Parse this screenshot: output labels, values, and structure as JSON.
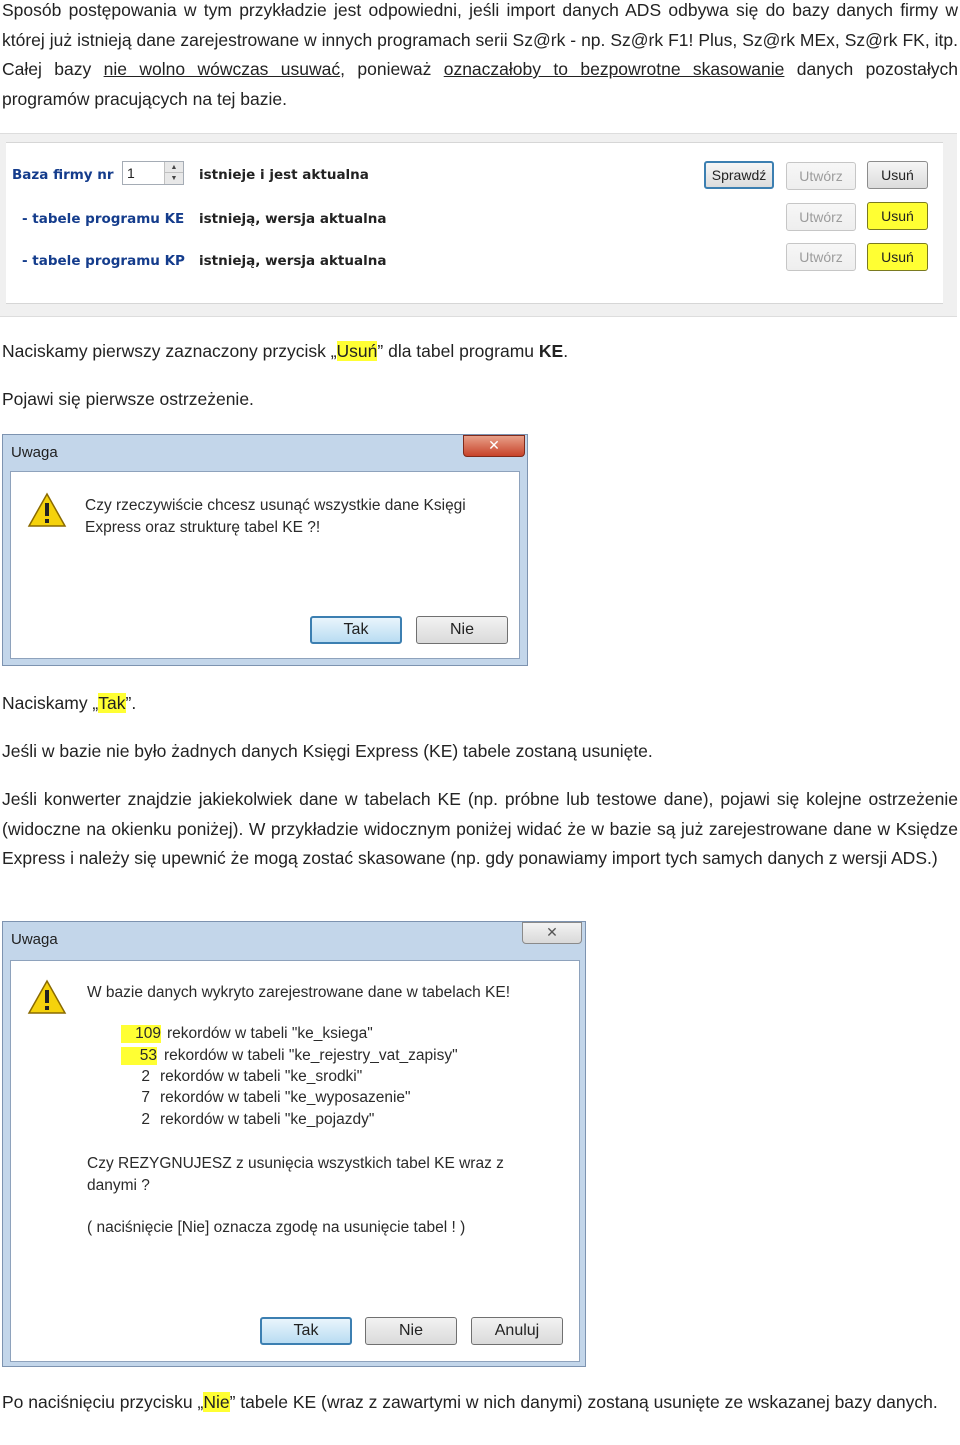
{
  "intro": {
    "line1": "Sposób postępowania w tym przykładzie jest odpowiedni, jeśli import danych ADS odbywa się do bazy danych firmy w której już istnieją dane zarejestrowane w innych programach serii Sz@rk - np. Sz@rk F1! Plus, Sz@rk MEx, Sz@rk FK, itp. Całej bazy ",
    "underline1": "nie wolno wówczas usuwać",
    "mid": ", ponieważ ",
    "underline2": "oznaczałoby to bezpowrotne skasowanie",
    "end": " danych pozostałych programów pracujących na tej bazie."
  },
  "panel": {
    "label_base": "Baza firmy nr",
    "spin_value": "1",
    "status_base": "istnieje i jest aktualna",
    "label_ke": "- tabele programu KE",
    "status_ke": "istnieją, wersja aktualna",
    "label_kp": "- tabele programu KP",
    "status_kp": "istnieją, wersja aktualna",
    "btn_check": "Sprawdź",
    "btn_create": "Utwórz",
    "btn_delete": "Usuń"
  },
  "step1": {
    "pre": "Naciskamy pierwszy zaznaczony przycisk „",
    "hl": "Usuń",
    "post": "” dla tabel programu ",
    "bold": "KE",
    "dot": "."
  },
  "step2": "Pojawi się pierwsze ostrzeżenie.",
  "dialog1": {
    "title": "Uwaga",
    "close": "✕",
    "msg1": "Czy rzeczywiście chcesz usunąć wszystkie dane Księgi",
    "msg2": "Express oraz strukturę tabel KE ?!",
    "yes": "Tak",
    "no": "Nie"
  },
  "step3": {
    "pre": "Naciskamy „",
    "hl": "Tak",
    "post": "”."
  },
  "para4": "Jeśli w bazie nie było żadnych danych Księgi Express (KE) tabele zostaną usunięte.",
  "para5": "Jeśli konwerter znajdzie jakiekolwiek dane w tabelach KE (np. próbne lub testowe dane), pojawi się kolejne ostrzeżenie (widoczne na okienku poniżej). W przykładzie widocznym poniżej widać że w bazie są już zarejestrowane dane w Księdze Express i należy się upewnić że mogą zostać skasowane (np. gdy ponawiamy import tych samych danych z wersji ADS.)",
  "dialog2": {
    "title": "Uwaga",
    "close": "✕",
    "heading": "W bazie danych wykryto zarejestrowane dane w tabelach KE!",
    "rows": [
      {
        "count": "109",
        "text": "rekordów w tabeli  \"ke_ksiega\""
      },
      {
        "count": "53",
        "text": "rekordów w tabeli  \"ke_rejestry_vat_zapisy\""
      },
      {
        "count": "2",
        "text": "rekordów w tabeli  \"ke_srodki\""
      },
      {
        "count": "7",
        "text": "rekordów w tabeli  \"ke_wyposazenie\""
      },
      {
        "count": "2",
        "text": "rekordów w tabeli  \"ke_pojazdy\""
      }
    ],
    "question1": "Czy REZYGNUJESZ z usunięcia wszystkich tabel KE wraz z",
    "question2": "danymi ?",
    "note": "( naciśnięcie [Nie] oznacza zgodę na usunięcie tabel ! )",
    "yes": "Tak",
    "no": "Nie",
    "cancel": "Anuluj"
  },
  "final": {
    "pre": "Po naciśnięciu przycisku „",
    "hl": "Nie",
    "post": "”  tabele KE (wraz z zawartymi w nich danymi) zostaną usunięte ze wskazanej bazy danych."
  },
  "colors": {
    "highlight": "#ffff33",
    "label_blue": "#143c8c",
    "dialog_frame": "#c3d6ea"
  }
}
